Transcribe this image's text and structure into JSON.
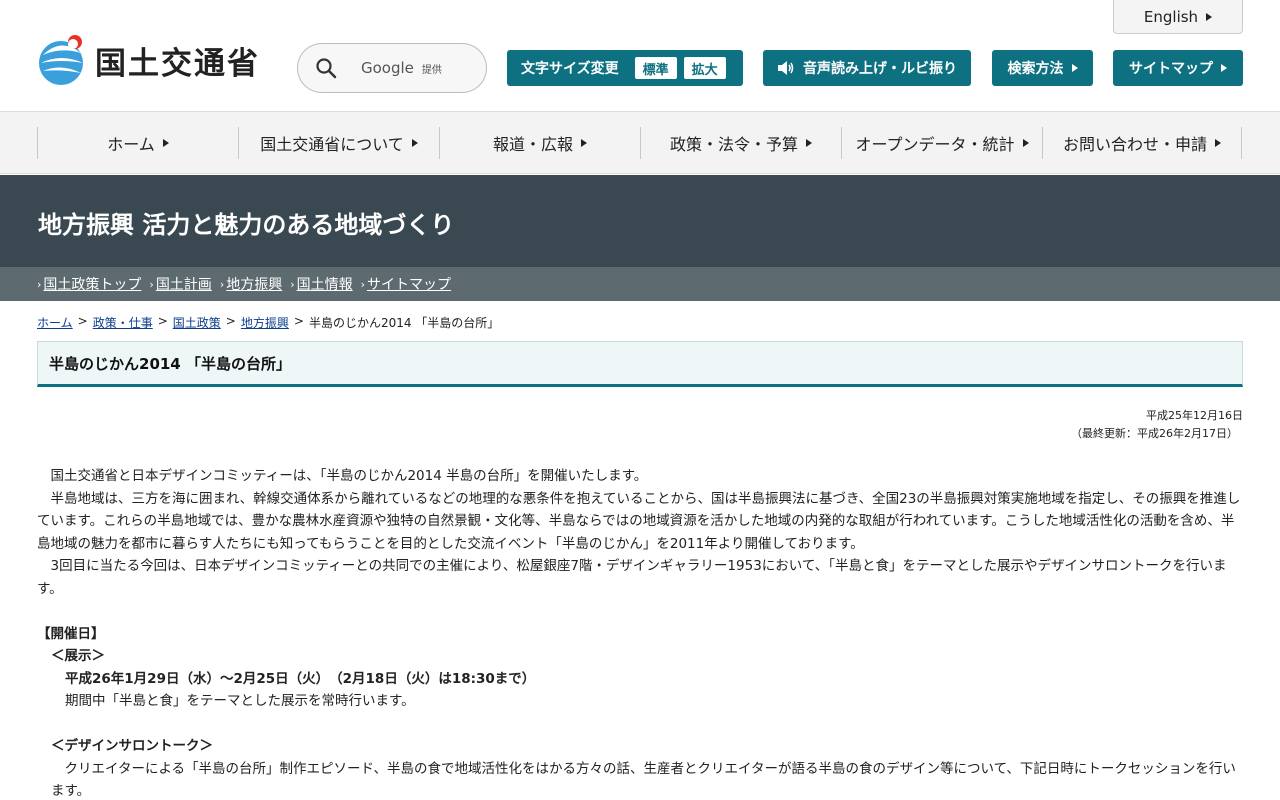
{
  "header": {
    "english_label": "English",
    "logo_text": "国土交通省",
    "search_brand": "Google",
    "search_sub": "提供",
    "font_size_label": "文字サイズ変更",
    "font_size_std": "標準",
    "font_size_large": "拡大",
    "voice_label": "音声読み上げ・ルビ振り",
    "search_method_label": "検索方法",
    "sitemap_label": "サイトマップ"
  },
  "gnav": [
    {
      "label": "ホーム"
    },
    {
      "label": "国土交通省について"
    },
    {
      "label": "報道・広報"
    },
    {
      "label": "政策・法令・予算"
    },
    {
      "label": "オープンデータ・統計"
    },
    {
      "label": "お問い合わせ・申請"
    }
  ],
  "banner": {
    "title": "地方振興 活力と魅力のある地域づくり"
  },
  "subnav": [
    {
      "label": "国土政策トップ"
    },
    {
      "label": "国土計画"
    },
    {
      "label": "地方振興"
    },
    {
      "label": "国土情報"
    },
    {
      "label": "サイトマップ"
    }
  ],
  "breadcrumb": {
    "items": [
      "ホーム",
      "政策・仕事",
      "国土政策",
      "地方振興"
    ],
    "current": "半島のじかん2014 「半島の台所」",
    "separator": ">"
  },
  "page": {
    "title": "半島のじかん2014 「半島の台所」",
    "date": "平成25年12月16日",
    "updated": "（最終更新：平成26年2月17日）",
    "paragraphs": [
      "　国土交通省と日本デザインコミッティーは、「半島のじかん2014 半島の台所」を開催いたします。",
      "　半島地域は、三方を海に囲まれ、幹線交通体系から離れているなどの地理的な悪条件を抱えていることから、国は半島振興法に基づき、全国23の半島振興対策実施地域を指定し、その振興を推進しています。これらの半島地域では、豊かな農林水産資源や独特の自然景観・文化等、半島ならではの地域資源を活かした地域の内発的な取組が行われています。こうした地域活性化の活動を含め、半島地域の魅力を都市に暮らす人たちにも知ってもらうことを目的とした交流イベント「半島のじかん」を2011年より開催しております。",
      "　3回目に当たる今回は、日本デザインコミッティーとの共同での主催により、松屋銀座7階・デザインギャラリー1953において、「半島と食」をテーマとした展示やデザインサロントークを行います。"
    ],
    "dates_heading": "【開催日】",
    "exhibit_heading": "＜展示＞",
    "exhibit_dates": "平成26年1月29日（水）～2月25日（火）　（2月18日（火）は18:30まで）",
    "exhibit_desc": "期間中「半島と食」をテーマとした展示を常時行います。",
    "talk_heading": "＜デザインサロントーク＞",
    "talk_desc": "　クリエイターによる「半島の台所」制作エピソード、半島の食で地域活性化をはかる方々の話、生産者とクリエイターが語る半島の食のデザイン等について、下記日時にトークセッションを行います。"
  },
  "colors": {
    "teal": "#0e7182",
    "banner": "#3a4951",
    "subnav": "#5d6b71"
  }
}
